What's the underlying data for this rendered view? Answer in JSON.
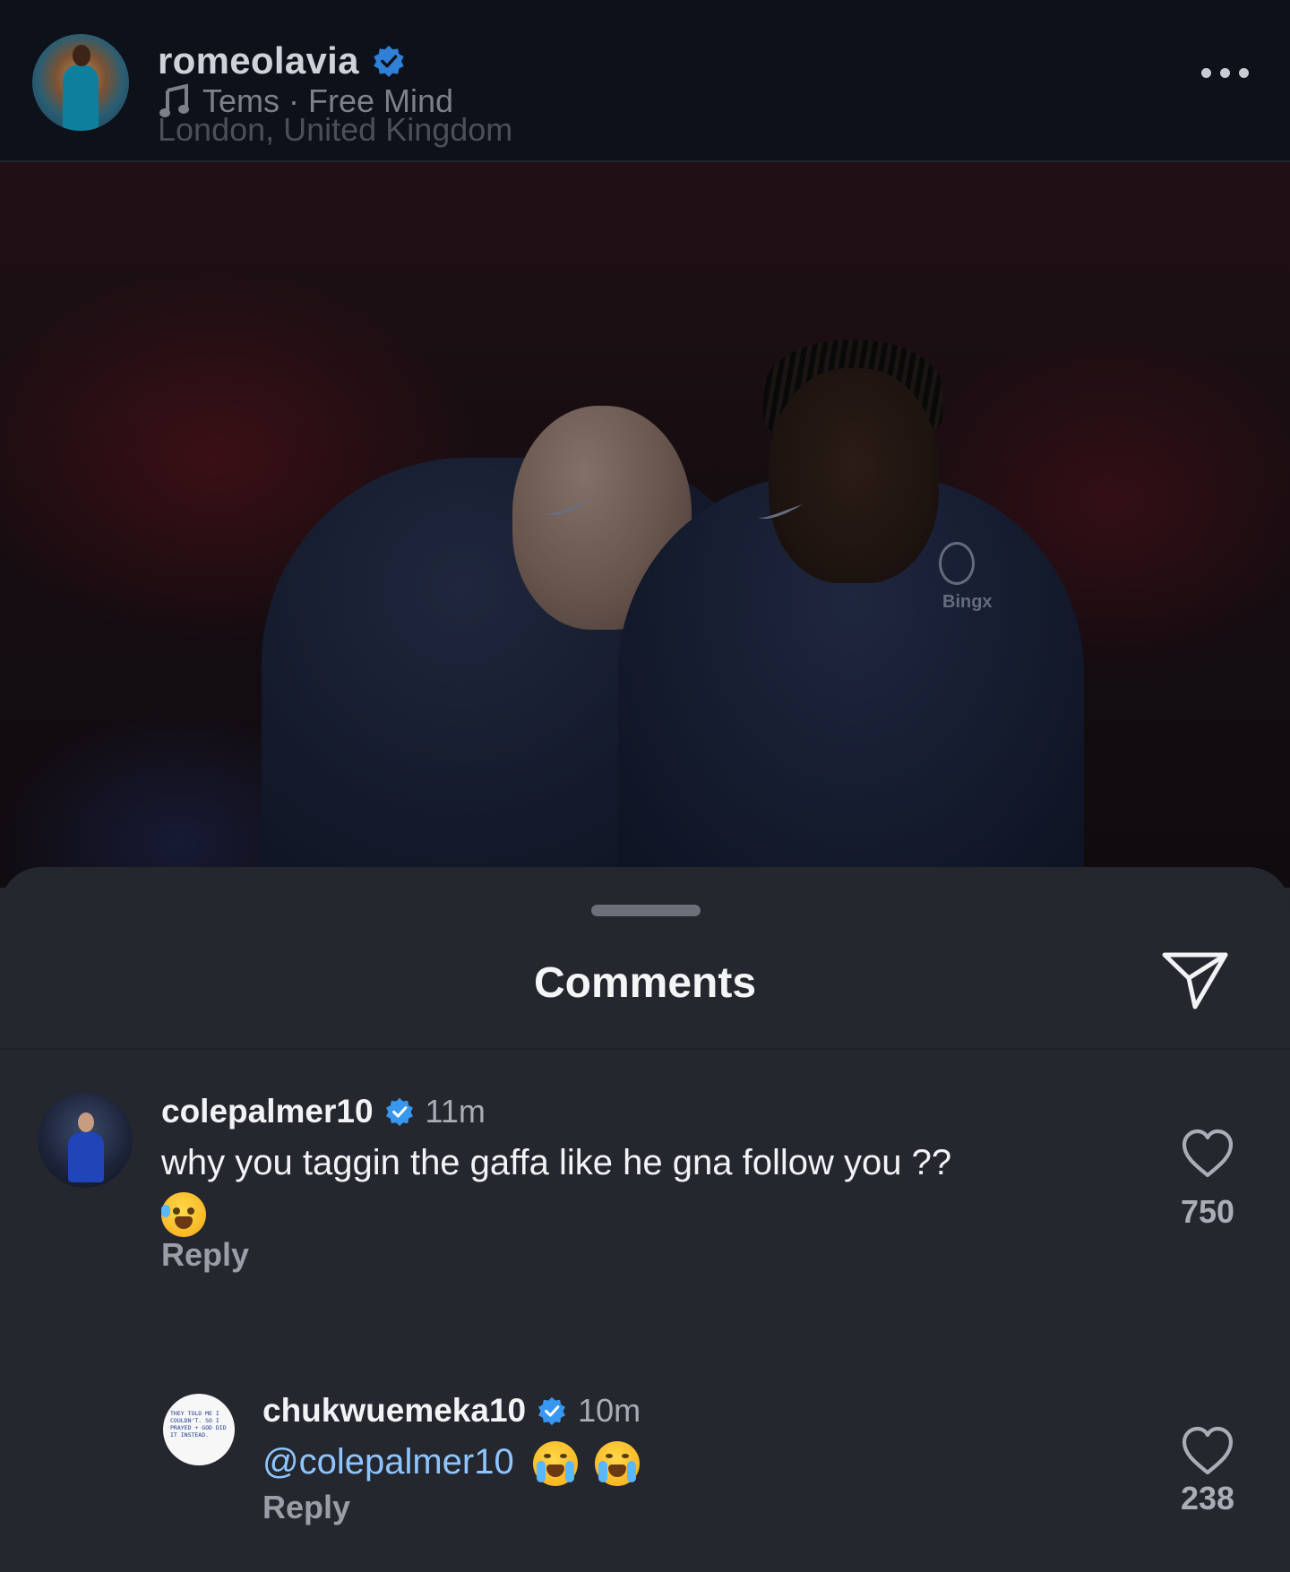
{
  "post": {
    "username": "romeolavia",
    "music": "Tems · Free Mind",
    "location": "London, United Kingdom",
    "more_icon": "more-horizontal-icon",
    "photo_text": [
      "Bingx"
    ]
  },
  "comments_sheet": {
    "title": "Comments",
    "share_icon": "send-icon",
    "comments": [
      {
        "username": "colepalmer10",
        "verified": true,
        "time": "11m",
        "text": "why you taggin the gaffa like he gna follow you ??",
        "emoji": "rolling-on-floor-laughing",
        "reply_label": "Reply",
        "likes": "750"
      },
      {
        "username": "chukwuemeka10",
        "verified": true,
        "time": "10m",
        "mention": "@colepalmer10",
        "emoji": [
          "loudly-crying-face",
          "loudly-crying-face"
        ],
        "reply_label": "Reply",
        "likes": "238",
        "avatar_text": "THEY TOLD ME I COULDN'T. SO I PRAYED + GOD DID IT INSTEAD."
      }
    ]
  },
  "colors": {
    "header_bg": "#0d1119",
    "sheet_bg": "#24272e",
    "verified_blue": "#3897f0",
    "mention_blue": "#8ec5ff"
  }
}
